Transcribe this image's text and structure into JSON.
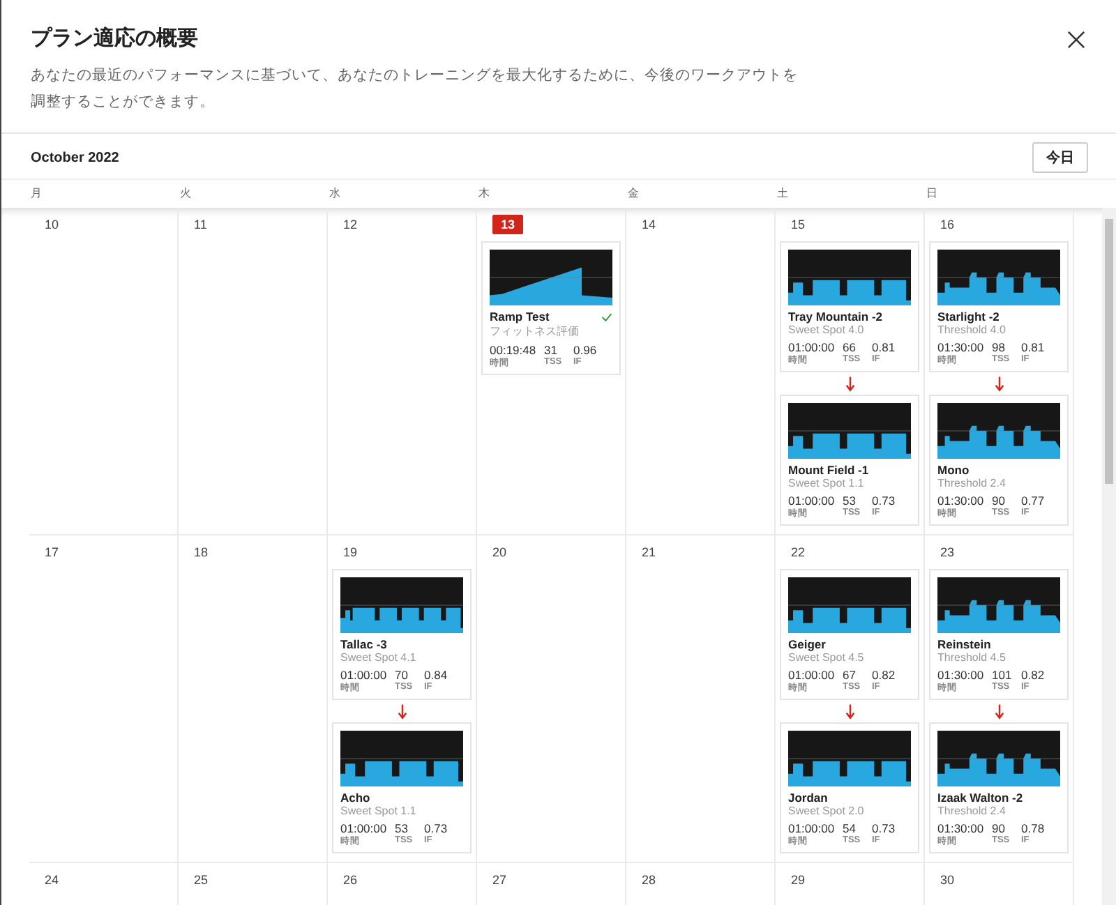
{
  "dialog": {
    "title": "プラン適応の概要",
    "description": "あなたの最近のパフォーマンスに基づいて、あなたのトレーニングを最大化するために、今後のワークアウトを調整することができます。"
  },
  "calendar": {
    "month": "October 2022",
    "today_button": "今日",
    "weekdays": [
      "月",
      "火",
      "水",
      "木",
      "金",
      "土",
      "日"
    ],
    "weeks": [
      {
        "days": [
          {
            "day": "10",
            "today": false
          },
          {
            "day": "11",
            "today": false
          },
          {
            "day": "12",
            "today": false
          },
          {
            "day": "13",
            "today": true,
            "workout": {
              "name": "Ramp Test",
              "subtitle": "フィットネス評価",
              "completed": true,
              "duration": "00:19:48",
              "duration_label": "時間",
              "tss": "31",
              "tss_label": "TSS",
              "if": "0.96",
              "if_label": "IF"
            }
          },
          {
            "day": "14",
            "today": false
          },
          {
            "day": "15",
            "today": false,
            "workout": {
              "name": "Tray Mountain -2",
              "subtitle": "Sweet Spot 4.0",
              "completed": false,
              "duration": "01:00:00",
              "duration_label": "時間",
              "tss": "66",
              "tss_label": "TSS",
              "if": "0.81",
              "if_label": "IF"
            },
            "adjusted_to": {
              "name": "Mount Field -1",
              "subtitle": "Sweet Spot 1.1",
              "completed": false,
              "duration": "01:00:00",
              "duration_label": "時間",
              "tss": "53",
              "tss_label": "TSS",
              "if": "0.73",
              "if_label": "IF"
            }
          },
          {
            "day": "16",
            "today": false,
            "workout": {
              "name": "Starlight -2",
              "subtitle": "Threshold 4.0",
              "completed": false,
              "duration": "01:30:00",
              "duration_label": "時間",
              "tss": "98",
              "tss_label": "TSS",
              "if": "0.81",
              "if_label": "IF"
            },
            "adjusted_to": {
              "name": "Mono",
              "subtitle": "Threshold 2.4",
              "completed": false,
              "duration": "01:30:00",
              "duration_label": "時間",
              "tss": "90",
              "tss_label": "TSS",
              "if": "0.77",
              "if_label": "IF"
            }
          }
        ]
      },
      {
        "days": [
          {
            "day": "17",
            "today": false
          },
          {
            "day": "18",
            "today": false
          },
          {
            "day": "19",
            "today": false,
            "workout": {
              "name": "Tallac -3",
              "subtitle": "Sweet Spot 4.1",
              "completed": false,
              "duration": "01:00:00",
              "duration_label": "時間",
              "tss": "70",
              "tss_label": "TSS",
              "if": "0.84",
              "if_label": "IF"
            },
            "adjusted_to": {
              "name": "Acho",
              "subtitle": "Sweet Spot 1.1",
              "completed": false,
              "duration": "01:00:00",
              "duration_label": "時間",
              "tss": "53",
              "tss_label": "TSS",
              "if": "0.73",
              "if_label": "IF"
            }
          },
          {
            "day": "20",
            "today": false
          },
          {
            "day": "21",
            "today": false
          },
          {
            "day": "22",
            "today": false,
            "workout": {
              "name": "Geiger",
              "subtitle": "Sweet Spot 4.5",
              "completed": false,
              "duration": "01:00:00",
              "duration_label": "時間",
              "tss": "67",
              "tss_label": "TSS",
              "if": "0.82",
              "if_label": "IF"
            },
            "adjusted_to": {
              "name": "Jordan",
              "subtitle": "Sweet Spot 2.0",
              "completed": false,
              "duration": "01:00:00",
              "duration_label": "時間",
              "tss": "54",
              "tss_label": "TSS",
              "if": "0.73",
              "if_label": "IF"
            }
          },
          {
            "day": "23",
            "today": false,
            "workout": {
              "name": "Reinstein",
              "subtitle": "Threshold 4.5",
              "completed": false,
              "duration": "01:30:00",
              "duration_label": "時間",
              "tss": "101",
              "tss_label": "TSS",
              "if": "0.82",
              "if_label": "IF"
            },
            "adjusted_to": {
              "name": "Izaak Walton -2",
              "subtitle": "Threshold 2.4",
              "completed": false,
              "duration": "01:30:00",
              "duration_label": "時間",
              "tss": "90",
              "tss_label": "TSS",
              "if": "0.78",
              "if_label": "IF"
            }
          }
        ]
      },
      {
        "days": [
          {
            "day": "24",
            "today": false
          },
          {
            "day": "25",
            "today": false
          },
          {
            "day": "26",
            "today": false
          },
          {
            "day": "27",
            "today": false
          },
          {
            "day": "28",
            "today": false
          },
          {
            "day": "29",
            "today": false
          },
          {
            "day": "30",
            "today": false
          }
        ]
      }
    ]
  }
}
